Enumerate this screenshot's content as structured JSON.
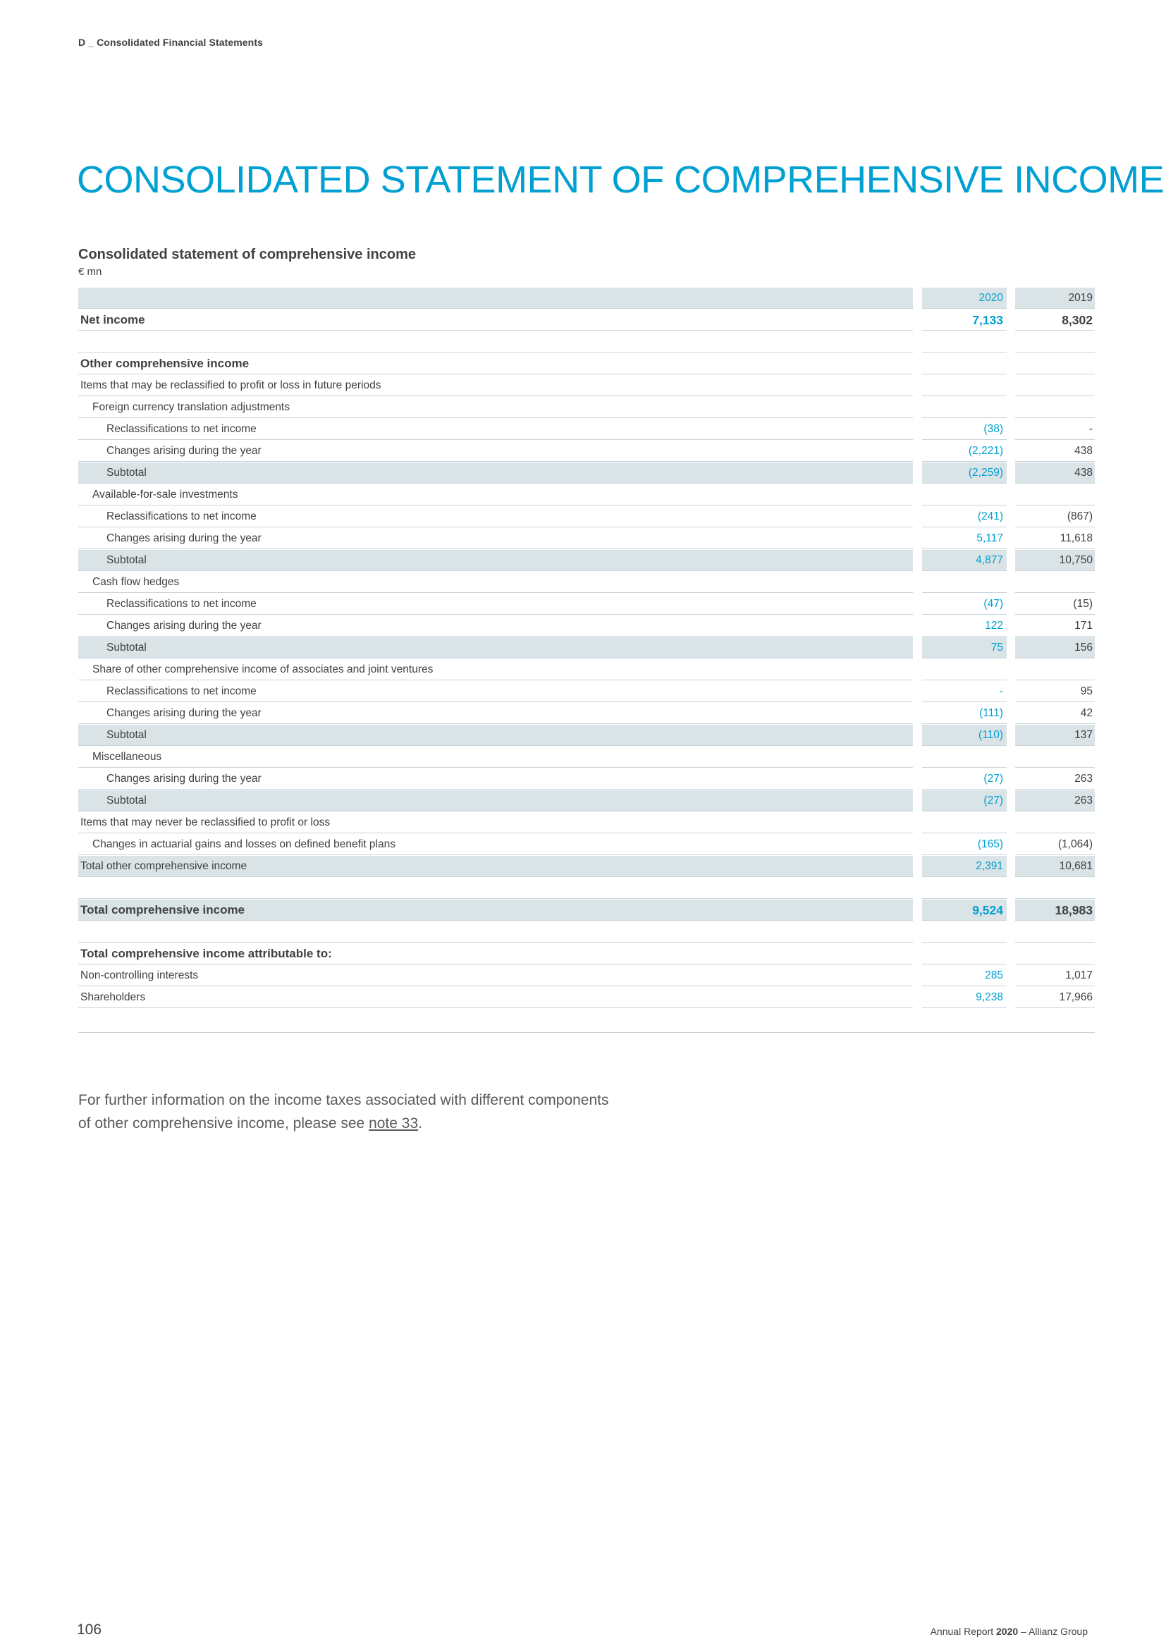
{
  "header": {
    "section": "D _ Consolidated Financial Statements"
  },
  "title": "CONSOLIDATED STATEMENT OF COMPREHENSIVE INCOME",
  "table": {
    "title": "Consolidated statement of comprehensive income",
    "unit": "€ mn",
    "columns": [
      "2020",
      "2019"
    ],
    "rows": [
      {
        "label": "Net income",
        "v2020": "7,133",
        "v2019": "8,302",
        "style": "bold",
        "indent": 0
      },
      {
        "label": "",
        "v2020": "",
        "v2019": "",
        "style": "blank",
        "indent": 0
      },
      {
        "label": "Other comprehensive income",
        "v2020": "",
        "v2019": "",
        "style": "bold",
        "indent": 0
      },
      {
        "label": "Items that may be reclassified to profit or loss in future periods",
        "v2020": "",
        "v2019": "",
        "style": "normal",
        "indent": 0
      },
      {
        "label": "Foreign currency translation adjustments",
        "v2020": "",
        "v2019": "",
        "style": "normal",
        "indent": 1
      },
      {
        "label": "Reclassifications to net income",
        "v2020": "(38)",
        "v2019": "-",
        "style": "normal",
        "indent": 2
      },
      {
        "label": "Changes arising during the year",
        "v2020": "(2,221)",
        "v2019": "438",
        "style": "normal",
        "indent": 2
      },
      {
        "label": "Subtotal",
        "v2020": "(2,259)",
        "v2019": "438",
        "style": "shade",
        "indent": 2
      },
      {
        "label": "Available-for-sale investments",
        "v2020": "",
        "v2019": "",
        "style": "normal",
        "indent": 1
      },
      {
        "label": "Reclassifications to net income",
        "v2020": "(241)",
        "v2019": "(867)",
        "style": "normal",
        "indent": 2
      },
      {
        "label": "Changes arising during the year",
        "v2020": "5,117",
        "v2019": "11,618",
        "style": "normal",
        "indent": 2
      },
      {
        "label": "Subtotal",
        "v2020": "4,877",
        "v2019": "10,750",
        "style": "shade",
        "indent": 2
      },
      {
        "label": "Cash flow hedges",
        "v2020": "",
        "v2019": "",
        "style": "normal",
        "indent": 1
      },
      {
        "label": "Reclassifications to net income",
        "v2020": "(47)",
        "v2019": "(15)",
        "style": "normal",
        "indent": 2
      },
      {
        "label": "Changes arising during the year",
        "v2020": "122",
        "v2019": "171",
        "style": "normal",
        "indent": 2
      },
      {
        "label": "Subtotal",
        "v2020": "75",
        "v2019": "156",
        "style": "shade",
        "indent": 2
      },
      {
        "label": "Share of other comprehensive income of associates and joint ventures",
        "v2020": "",
        "v2019": "",
        "style": "normal",
        "indent": 1
      },
      {
        "label": "Reclassifications to net income",
        "v2020": "-",
        "v2019": "95",
        "style": "normal",
        "indent": 2
      },
      {
        "label": "Changes arising during the year",
        "v2020": "(111)",
        "v2019": "42",
        "style": "normal",
        "indent": 2
      },
      {
        "label": "Subtotal",
        "v2020": "(110)",
        "v2019": "137",
        "style": "shade",
        "indent": 2
      },
      {
        "label": "Miscellaneous",
        "v2020": "",
        "v2019": "",
        "style": "normal",
        "indent": 1
      },
      {
        "label": "Changes arising during the year",
        "v2020": "(27)",
        "v2019": "263",
        "style": "normal",
        "indent": 2
      },
      {
        "label": "Subtotal",
        "v2020": "(27)",
        "v2019": "263",
        "style": "shade",
        "indent": 2
      },
      {
        "label": "Items that may never be reclassified to profit or loss",
        "v2020": "",
        "v2019": "",
        "style": "normal",
        "indent": 0
      },
      {
        "label": "Changes in actuarial gains and losses on defined benefit plans",
        "v2020": "(165)",
        "v2019": "(1,064)",
        "style": "normal",
        "indent": 1
      },
      {
        "label": "Total other comprehensive income",
        "v2020": "2,391",
        "v2019": "10,681",
        "style": "shade",
        "indent": 0
      },
      {
        "label": "",
        "v2020": "",
        "v2019": "",
        "style": "blank",
        "indent": 0
      },
      {
        "label": "Total comprehensive income",
        "v2020": "9,524",
        "v2019": "18,983",
        "style": "shade-bold",
        "indent": 0
      },
      {
        "label": "",
        "v2020": "",
        "v2019": "",
        "style": "blank",
        "indent": 0
      },
      {
        "label": "Total comprehensive income attributable to:",
        "v2020": "",
        "v2019": "",
        "style": "bold",
        "indent": 0
      },
      {
        "label": "Non-controlling interests",
        "v2020": "285",
        "v2019": "1,017",
        "style": "normal",
        "indent": 0
      },
      {
        "label": "Shareholders",
        "v2020": "9,238",
        "v2019": "17,966",
        "style": "normal",
        "indent": 0
      }
    ]
  },
  "footnote": {
    "text": "For further information on the income taxes associated with different components of other comprehensive income, please see ",
    "link": "note 33",
    "end": "."
  },
  "footer": {
    "page_number": "106",
    "report_prefix": "Annual Report ",
    "report_year": "2020",
    "report_suffix": " – Allianz Group"
  }
}
